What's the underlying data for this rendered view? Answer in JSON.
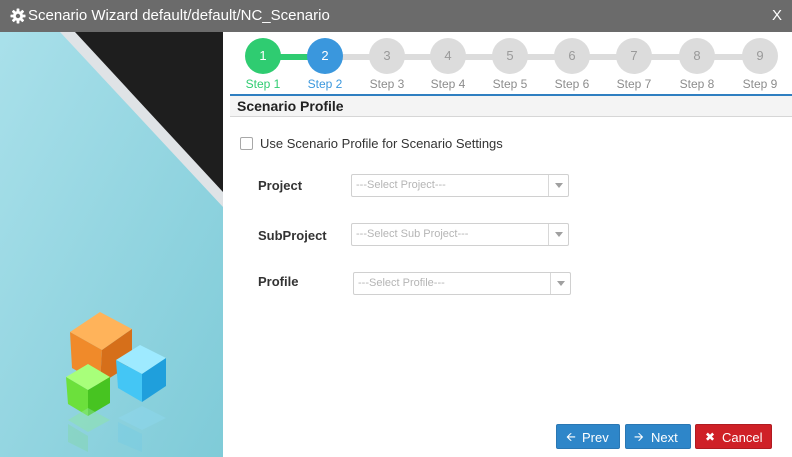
{
  "window": {
    "title": "Scenario Wizard default/default/NC_Scenario",
    "close_label": "X"
  },
  "steps": [
    {
      "number": "1",
      "label": "Step 1",
      "state": "done"
    },
    {
      "number": "2",
      "label": "Step 2",
      "state": "active"
    },
    {
      "number": "3",
      "label": "Step 3",
      "state": "pending"
    },
    {
      "number": "4",
      "label": "Step 4",
      "state": "pending"
    },
    {
      "number": "5",
      "label": "Step 5",
      "state": "pending"
    },
    {
      "number": "6",
      "label": "Step 6",
      "state": "pending"
    },
    {
      "number": "7",
      "label": "Step 7",
      "state": "pending"
    },
    {
      "number": "8",
      "label": "Step 8",
      "state": "pending"
    },
    {
      "number": "9",
      "label": "Step 9",
      "state": "pending"
    }
  ],
  "section": {
    "title": "Scenario Profile"
  },
  "form": {
    "use_profile_label": "Use Scenario Profile for Scenario Settings",
    "use_profile_checked": false,
    "project": {
      "label": "Project",
      "placeholder": "---Select Project---"
    },
    "subproject": {
      "label": "SubProject",
      "placeholder": "---Select Sub Project---"
    },
    "profile": {
      "label": "Profile",
      "placeholder": "---Select Profile---"
    }
  },
  "buttons": {
    "prev": "Prev",
    "next": "Next",
    "cancel": "Cancel"
  },
  "colors": {
    "done": "#2fcc71",
    "active": "#3a97dd",
    "pending": "#dcdcdc",
    "primary_button": "#2e86c9",
    "cancel_button": "#cf2027",
    "titlebar": "#6b6b6b"
  },
  "icons": {
    "title": "gear-icon",
    "prev": "arrow-left-icon",
    "next": "arrow-right-icon",
    "cancel": "times-icon"
  }
}
